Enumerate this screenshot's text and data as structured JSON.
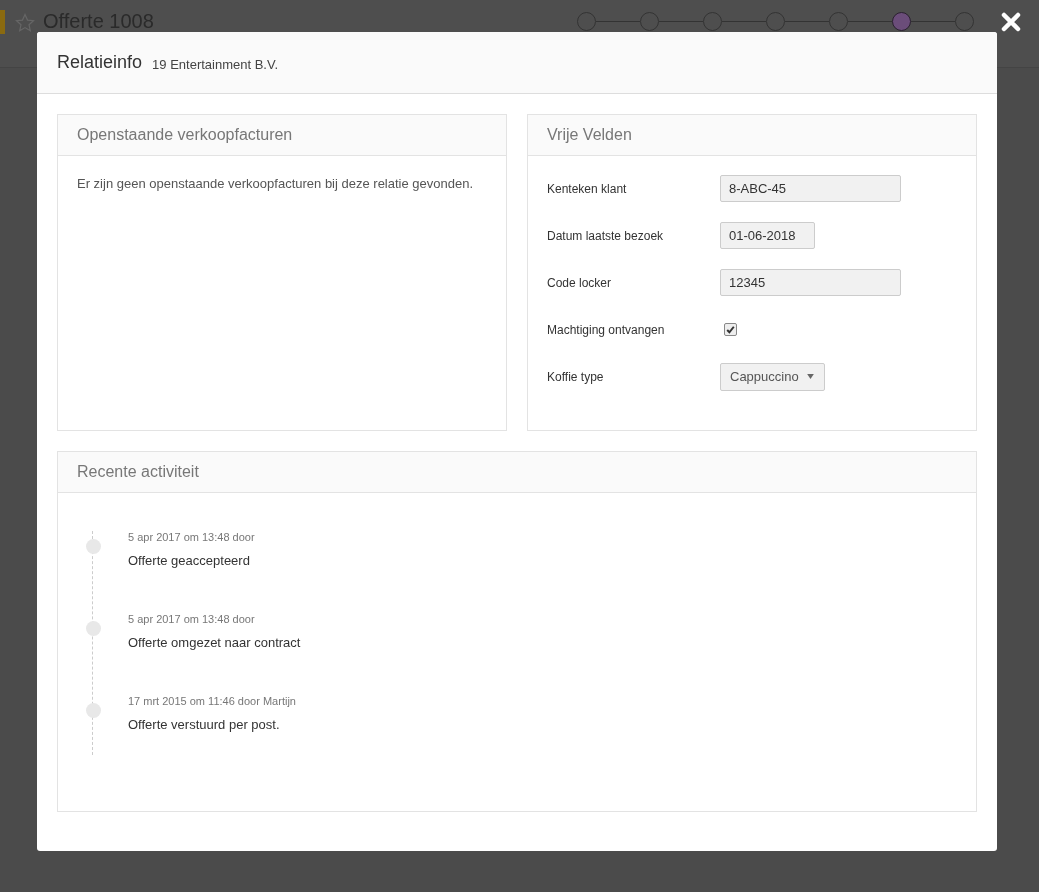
{
  "page": {
    "title": "Offerte 1008",
    "favorite": false,
    "steps": [
      {
        "selected": false
      },
      {
        "selected": false
      },
      {
        "selected": false
      },
      {
        "selected": false
      },
      {
        "selected": false
      },
      {
        "selected": true
      },
      {
        "selected": false
      }
    ]
  },
  "modal": {
    "title": "Relatieinfo",
    "subtitle": "19 Entertainment B.V.",
    "invoices": {
      "title": "Openstaande verkoopfacturen",
      "message": "Er zijn geen openstaande verkoopfacturen bij deze relatie gevonden."
    },
    "fields": {
      "title": "Vrije Velden",
      "items": [
        {
          "kind": "text",
          "label": "Kenteken klant",
          "value": "8-ABC-45"
        },
        {
          "kind": "date",
          "label": "Datum laatste bezoek",
          "value": "01-06-2018"
        },
        {
          "kind": "text",
          "label": "Code locker",
          "value": "12345"
        },
        {
          "kind": "checkbox",
          "label": "Machtiging ontvangen",
          "checked": true
        },
        {
          "kind": "select",
          "label": "Koffie type",
          "value": "Cappuccino"
        }
      ]
    },
    "activity": {
      "title": "Recente activiteit",
      "items": [
        {
          "meta": "5 apr 2017 om 13:48 door",
          "text": "Offerte geaccepteerd"
        },
        {
          "meta": "5 apr 2017 om 13:48 door",
          "text": "Offerte omgezet naar contract"
        },
        {
          "meta": "17 mrt 2015 om 11:46 door Martijn",
          "text": "Offerte verstuurd per post."
        }
      ]
    }
  }
}
